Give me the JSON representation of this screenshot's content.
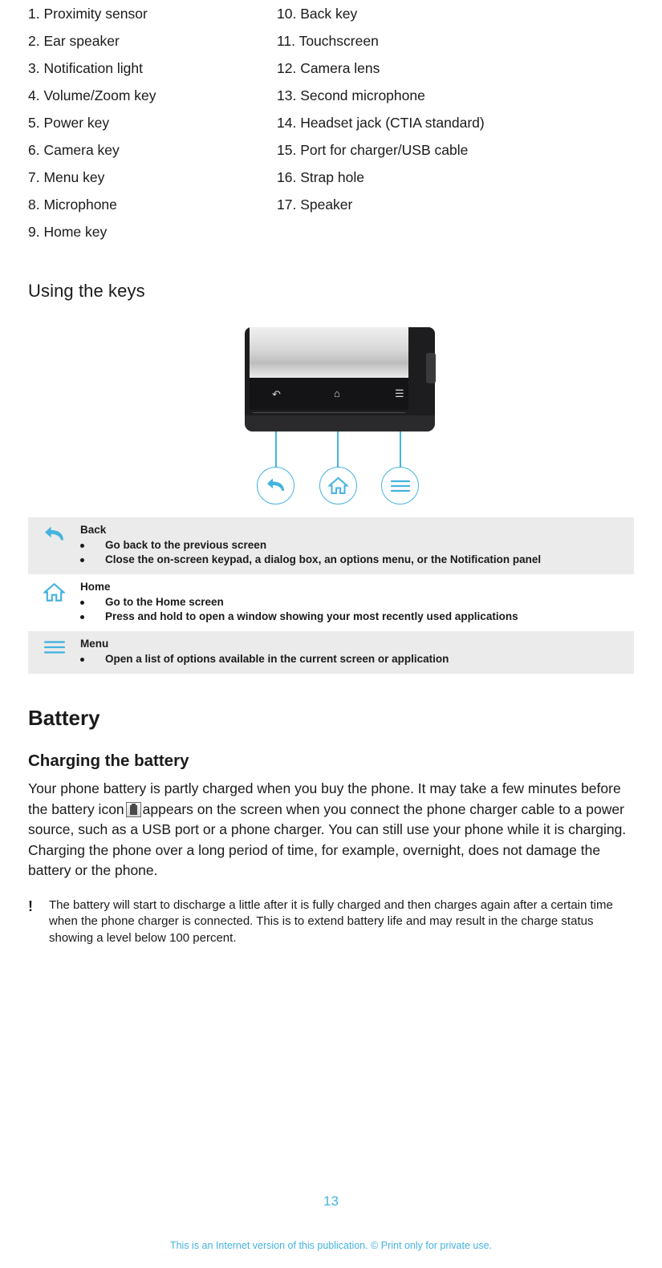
{
  "parts": {
    "left_column": [
      "1. Proximity sensor",
      "2. Ear speaker",
      "3. Notification light",
      "4. Volume/Zoom key",
      "5. Power key",
      "6. Camera key",
      "7. Menu key",
      "8. Microphone",
      "9. Home key"
    ],
    "right_column": [
      "10. Back key",
      "11. Touchscreen",
      "12. Camera lens",
      "13. Second microphone",
      "14. Headset jack (CTIA standard)",
      "15. Port for charger/USB cable",
      "16. Strap hole",
      "17. Speaker"
    ]
  },
  "using_keys": {
    "heading": "Using the keys",
    "rows": [
      {
        "icon": "back-arrow-icon",
        "title": "Back",
        "bullets": [
          "Go back to the previous screen",
          "Close the on-screen keypad, a dialog box, an options menu, or the Notification panel"
        ]
      },
      {
        "icon": "home-house-icon",
        "title": "Home",
        "bullets": [
          "Go to the Home screen",
          "Press and hold to open a window showing your most recently used applications"
        ]
      },
      {
        "icon": "menu-lines-icon",
        "title": "Menu",
        "bullets": [
          "Open a list of options available in the current screen or application"
        ]
      }
    ]
  },
  "battery": {
    "chapter_title": "Battery",
    "sub_title": "Charging the battery",
    "paragraph_part1": "Your phone battery is partly charged when you buy the phone. It may take a few minutes before the battery icon",
    "paragraph_part2": "appears on the screen when you connect the phone charger cable to a power source, such as a USB port or a phone charger. You can still use your phone while it is charging. Charging the phone over a long period of time, for example, overnight, does not damage the battery or the phone.",
    "note_icon": "!",
    "note_text": "The battery will start to discharge a little after it is fully charged and then charges again after a certain time when the phone charger is connected. This is to extend battery life and may result in the charge status showing a level below 100 percent."
  },
  "footer": {
    "page_number": "13",
    "note": "This is an Internet version of this publication. © Print only for private use."
  },
  "colors": {
    "accent": "#45b3e0",
    "text": "#1a1a1a",
    "row_shade": "#ebebeb"
  }
}
